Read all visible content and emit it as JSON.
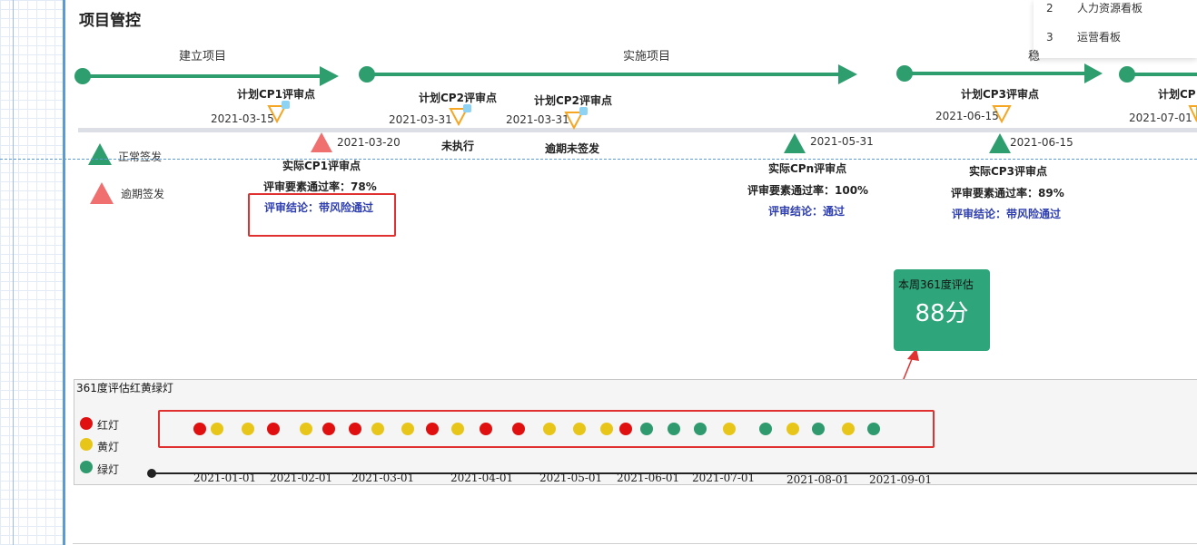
{
  "page": {
    "title": "项目管控"
  },
  "menu": {
    "items": [
      {
        "num": "2",
        "label": "人力资源看板"
      },
      {
        "num": "3",
        "label": "运营看板"
      }
    ]
  },
  "phases": {
    "build": "建立项目",
    "implement": "实施项目",
    "third": "稳"
  },
  "plan_points": {
    "cp1": {
      "label": "计划CP1评审点",
      "date": "2021-03-15"
    },
    "cp2a": {
      "label": "计划CP2评审点",
      "date": "2021-03-31",
      "status": "未执行"
    },
    "cp2b": {
      "label": "计划CP2评审点",
      "date": "2021-03-31",
      "status": "逾期未签发"
    },
    "cp3": {
      "label": "计划CP3评审点",
      "date": "2021-06-15"
    },
    "cp4": {
      "label": "计划CP",
      "date": "2021-07-01"
    }
  },
  "actual_points": {
    "cp1": {
      "date": "2021-03-20",
      "label": "实际CP1评审点",
      "rate": "评审要素通过率：78%",
      "conclusion": "评审结论：带风险通过"
    },
    "cpn": {
      "date": "2021-05-31",
      "label": "实际CPn评审点",
      "rate": "评审要素通过率：100%",
      "conclusion": "评审结论：通过"
    },
    "cp3": {
      "date": "2021-06-15",
      "label": "实际CP3评审点",
      "rate": "评审要素通过率：89%",
      "conclusion": "评审结论：带风险通过"
    }
  },
  "legend": {
    "normal": "正常签发",
    "overdue": "逾期签发"
  },
  "colors": {
    "green": "#2e9e6e",
    "red_triangle": "#f07070",
    "orange": "#f5a623",
    "red_lamp": "#e01010",
    "yellow_lamp": "#e8c619",
    "green_lamp": "#2e9a6e",
    "conclusion_text": "#2f3fb0"
  },
  "score": {
    "title": "本周361度评估",
    "value": "88分"
  },
  "lamp": {
    "title": "361度评估红黄绿灯",
    "legend": {
      "red": "红灯",
      "yellow": "黄灯",
      "green": "绿灯"
    },
    "dates": [
      "2021-01-01",
      "2021-02-01",
      "2021-03-01",
      "2021-04-01",
      "2021-05-01",
      "2021-06-01",
      "2021-07-01",
      "2021-08-01",
      "2021-09-01"
    ],
    "sequence": [
      "red",
      "yellow",
      "yellow",
      "red",
      "yellow",
      "red",
      "red",
      "yellow",
      "yellow",
      "red",
      "yellow",
      "red",
      "red",
      "yellow",
      "yellow",
      "yellow",
      "red",
      "green",
      "green",
      "green",
      "yellow",
      "green",
      "yellow",
      "green",
      "yellow",
      "green"
    ]
  }
}
